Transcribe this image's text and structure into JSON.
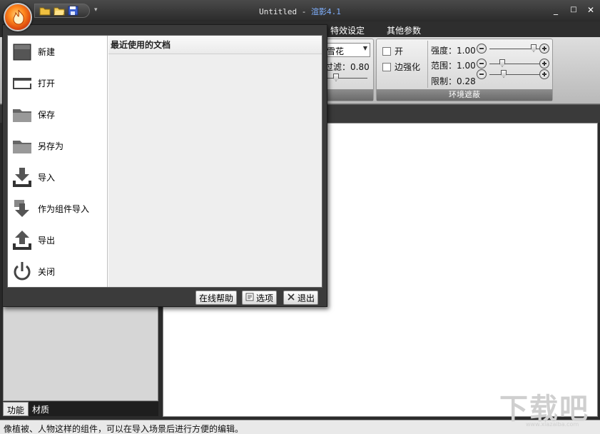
{
  "window": {
    "title": "Untitled - ",
    "subtitle": "渲影4.1",
    "minimize": "_",
    "maximize": "□",
    "close": "✕"
  },
  "quick_access": {
    "more": "▾"
  },
  "ribbon": {
    "tabs": [
      "特效设定",
      "其他参数"
    ],
    "combo_value": "雪花",
    "filter_label": "过滤：0.80",
    "ao": {
      "enable_label": "开",
      "edge_label": "边强化",
      "strength_label": "强度：1.00",
      "range_label": "范围：1.00",
      "limit_label": "限制：0.28",
      "group_label": "环境遮蔽"
    }
  },
  "app_menu": {
    "items": [
      "新建",
      "打开",
      "保存",
      "另存为",
      "导入",
      "作为组件导入",
      "导出",
      "关闭"
    ],
    "recent_title": "最近使用的文档",
    "buttons": {
      "help": "在线帮助",
      "options": "选项",
      "exit": "退出"
    }
  },
  "left_tabs": [
    "功能",
    "材质"
  ],
  "status_text": "像植被、人物这样的组件，可以在导入场景后进行方便的编辑。",
  "watermark": {
    "main": "下载吧",
    "sub": "www.xiazaiba.com"
  }
}
